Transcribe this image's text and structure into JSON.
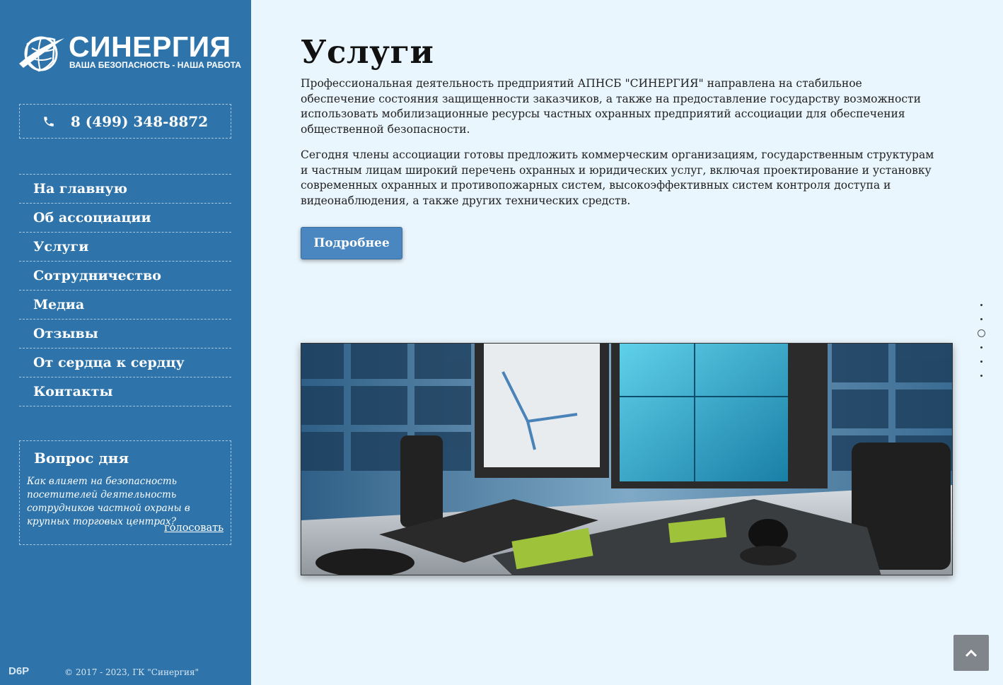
{
  "sidebar": {
    "logo": {
      "title": "СИНЕРГИЯ",
      "subtitle": "ВАША БЕЗОПАСНОСТЬ - НАША РАБОТА",
      "icon": "globe-shield-icon"
    },
    "phone": {
      "icon": "phone-icon",
      "number": "8 (499) 348-8872"
    },
    "nav": [
      {
        "label": "На главную"
      },
      {
        "label": "Об ассоциации"
      },
      {
        "label": "Услуги"
      },
      {
        "label": "Сотрудничество"
      },
      {
        "label": "Медиа"
      },
      {
        "label": "Отзывы"
      },
      {
        "label": "От сердца к сердцу"
      },
      {
        "label": "Контакты"
      }
    ],
    "question": {
      "title": "Вопрос дня",
      "text": "Как влияет на безопасность посетителей деятельность сотрудников частной охраны в крупных торговых центрах?",
      "vote_link": "голосовать"
    },
    "developer_logo": "D6P",
    "copyright": "© 2017 - 2023, ГК \"Синергия\""
  },
  "main": {
    "title": "Услуги",
    "paragraphs": [
      "Профессиональная деятельность предприятий АПНСБ \"СИНЕРГИЯ\" направлена на стабильное обеспечение состояния защищенности заказчиков, а также на предоставление государству возможности использовать мобилизационные ресурсы частных охранных предприятий ассоциации для обеспечения общественной безопасности.",
      "Сегодня члены ассоциации готовы предложить коммерческим организациям, государственным структурам и частным лицам широкий перечень охранных и юридических услуг, включая проектирование и установку современных охранных и противопожарных систем, высокоэффективных систем контроля доступа и видеонаблюдения, а также других технических средств."
    ],
    "more_button": "Подробнее",
    "hero_image": "security-control-room-image"
  },
  "slider": {
    "count": 6,
    "active_index": 2
  },
  "scroll_top": {
    "icon": "chevron-up-icon"
  },
  "colors": {
    "sidebar": "#2e74aa",
    "background": "#eaf6fd",
    "button": "#4a87c1"
  }
}
